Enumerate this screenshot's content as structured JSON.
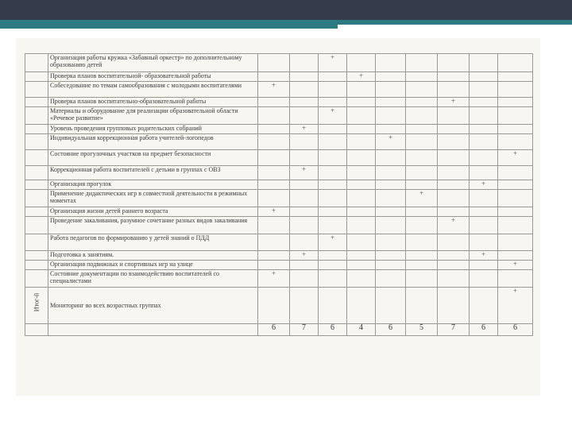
{
  "side_label": "Итог-й",
  "rows": [
    {
      "task": "Организация работы кружка «Забавный оркестр» по дополнительному образованию детей",
      "marks": [
        "",
        "",
        "+",
        "",
        "",
        "",
        "",
        "",
        ""
      ]
    },
    {
      "task": "Проверка планов воспитательной- образовательной работы",
      "marks": [
        "",
        "",
        "",
        "+",
        "",
        "",
        "",
        "",
        ""
      ]
    },
    {
      "task": "Собеседование по темам самообразования с молодыми воспитателями",
      "marks": [
        "+",
        "",
        "",
        "",
        "",
        "",
        "",
        "",
        ""
      ]
    },
    {
      "task": "Проверка планов воспитательно-образовательной работы",
      "marks": [
        "",
        "",
        "",
        "",
        "",
        "",
        "+",
        "",
        ""
      ]
    },
    {
      "task": "Материалы и оборудование для реализации образовательной области «Речевое развитие»",
      "marks": [
        "",
        "",
        "+",
        "",
        "",
        "",
        "",
        "",
        ""
      ]
    },
    {
      "task": "Уровень проведения групповых родительских собраний",
      "marks": [
        "",
        "+",
        "",
        "",
        "",
        "",
        "",
        "",
        ""
      ]
    },
    {
      "task": "Индивидуальная коррекционная работа учителей-логопедов",
      "marks": [
        "",
        "",
        "",
        "",
        "+",
        "",
        "",
        "",
        ""
      ]
    },
    {
      "task": "Состояние прогулочных участков на предмет безопасности",
      "marks": [
        "",
        "",
        "",
        "",
        "",
        "",
        "",
        "",
        "+"
      ]
    },
    {
      "task": "Коррекционная работа воспитателей с детьми в группах с ОВЗ",
      "marks": [
        "",
        "+",
        "",
        "",
        "",
        "",
        "",
        "",
        ""
      ]
    },
    {
      "task": "Организация прогулок",
      "marks": [
        "",
        "",
        "",
        "",
        "",
        "",
        "",
        "+",
        ""
      ]
    },
    {
      "task": "Применение дидактических игр в совместной деятельности в режимных моментах",
      "marks": [
        "",
        "",
        "",
        "",
        "",
        "+",
        "",
        "",
        ""
      ]
    },
    {
      "task": "Организация жизни детей раннего возраста",
      "marks": [
        "+",
        "",
        "",
        "",
        "",
        "",
        "",
        "",
        ""
      ]
    },
    {
      "task": "Проведение закаливания, разумное сочетание разных видов закаливания",
      "marks": [
        "",
        "",
        "",
        "",
        "",
        "",
        "+",
        "",
        ""
      ]
    },
    {
      "task": "Работа педагогов по формированию у детей знаний о ПДД",
      "marks": [
        "",
        "",
        "+",
        "",
        "",
        "",
        "",
        "",
        ""
      ]
    },
    {
      "task": "Подготовка к занятиям.",
      "marks": [
        "",
        "+",
        "",
        "",
        "",
        "",
        "",
        "+",
        ""
      ]
    },
    {
      "task": "Организация подвижных и спортивных игр на улице",
      "marks": [
        "",
        "",
        "",
        "",
        "",
        "",
        "",
        "",
        "+"
      ]
    },
    {
      "task": "Состояние документации по взаимодействию воспитателей со специалистами",
      "marks": [
        "+",
        "",
        "",
        "",
        "",
        "",
        "",
        "",
        ""
      ]
    },
    {
      "task": "Мониторинг во всех возрастных группах",
      "marks": [
        "",
        "",
        "",
        "",
        "",
        "",
        "",
        "",
        "+"
      ]
    }
  ],
  "totals": [
    "6",
    "7",
    "6",
    "4",
    "6",
    "5",
    "7",
    "6",
    "6"
  ]
}
